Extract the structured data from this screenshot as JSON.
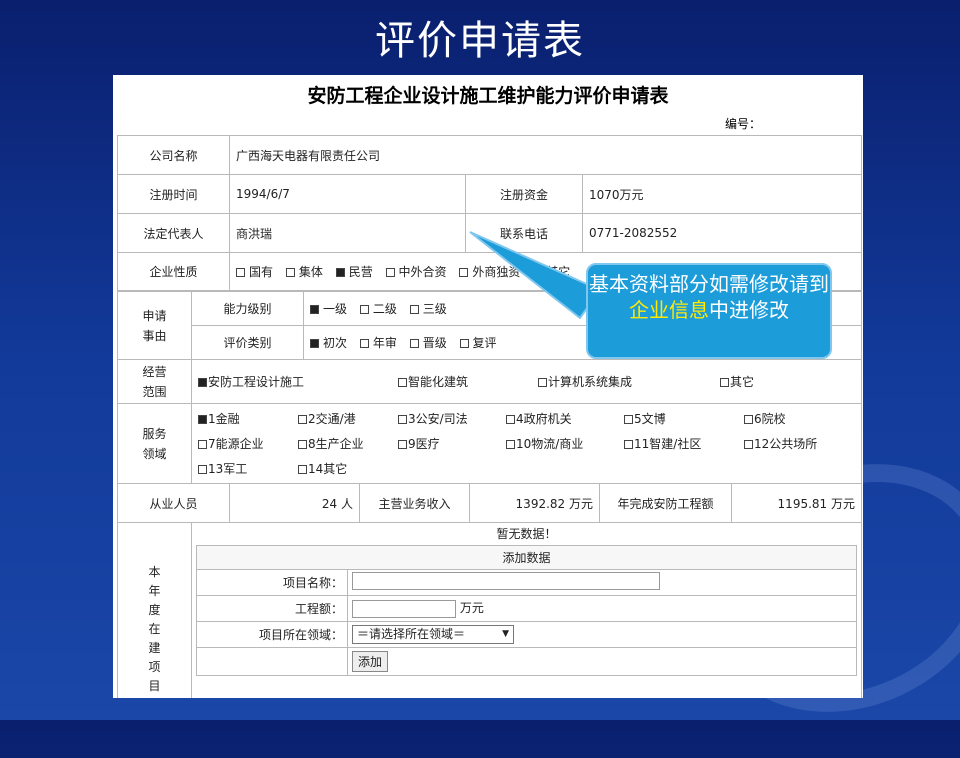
{
  "slide_title": "评价申请表",
  "form": {
    "title": "安防工程企业设计施工维护能力评价申请表",
    "serial_label": "编号：",
    "company_name_label": "公司名称",
    "company_name": "广西海天电器有限责任公司",
    "reg_date_label": "注册时间",
    "reg_date": "1994/6/7",
    "reg_capital_label": "注册资金",
    "reg_capital": "1070万元",
    "legal_rep_label": "法定代表人",
    "legal_rep": "商洪瑞",
    "phone_label": "联系电话",
    "phone": "0771-2082552",
    "nature_label": "企业性质",
    "nature_options": [
      {
        "label": "国有",
        "checked": false
      },
      {
        "label": "集体",
        "checked": false
      },
      {
        "label": "民营",
        "checked": true
      },
      {
        "label": "中外合资",
        "checked": false
      },
      {
        "label": "外商独资",
        "checked": false
      },
      {
        "label": "其它",
        "checked": false
      }
    ],
    "apply_label": "申请事由",
    "level_label": "能力级别",
    "level_options": [
      {
        "label": "一级",
        "checked": true
      },
      {
        "label": "二级",
        "checked": false
      },
      {
        "label": "三级",
        "checked": false
      }
    ],
    "eval_type_label": "评价类别",
    "eval_type_options": [
      {
        "label": "初次",
        "checked": true
      },
      {
        "label": "年审",
        "checked": false
      },
      {
        "label": "晋级",
        "checked": false
      },
      {
        "label": "复评",
        "checked": false
      }
    ],
    "scope_label": "经营范围",
    "scope_options": [
      {
        "label": "安防工程设计施工",
        "checked": true
      },
      {
        "label": "智能化建筑",
        "checked": false
      },
      {
        "label": "计算机系统集成",
        "checked": false
      },
      {
        "label": "其它",
        "checked": false
      }
    ],
    "service_label": "服务领域",
    "service_options": [
      {
        "label": "1金融",
        "checked": true
      },
      {
        "label": "2交通/港",
        "checked": false
      },
      {
        "label": "3公安/司法",
        "checked": false
      },
      {
        "label": "4政府机关",
        "checked": false
      },
      {
        "label": "5文博",
        "checked": false
      },
      {
        "label": "6院校",
        "checked": false
      },
      {
        "label": "7能源企业",
        "checked": false
      },
      {
        "label": "8生产企业",
        "checked": false
      },
      {
        "label": "9医疗",
        "checked": false
      },
      {
        "label": "10物流/商业",
        "checked": false
      },
      {
        "label": "11智建/社区",
        "checked": false
      },
      {
        "label": "12公共场所",
        "checked": false
      },
      {
        "label": "13军工",
        "checked": false
      },
      {
        "label": "14其它",
        "checked": false
      }
    ],
    "staff_label": "从业人员",
    "staff_value": "24 人",
    "revenue_label": "主营业务收入",
    "revenue_value": "1392.82 万元",
    "completed_label": "年完成安防工程额",
    "completed_value": "1195.81 万元",
    "projects_label": "本年度在建项目",
    "no_data": "暂无数据！",
    "add_data": "添加数据",
    "project_name_label": "项目名称：",
    "project_amount_label": "工程额：",
    "project_amount_unit": "万元",
    "project_field_label": "项目所在领域：",
    "project_field_select": "＝请选择所在领域＝",
    "add_button": "添加"
  },
  "callout": {
    "text_before": "基本资料部分如需修改请到",
    "highlight": "企业信息",
    "text_after": "中进修改"
  },
  "colors": {
    "background": "#123a9a",
    "callout": "#1c9cd8",
    "highlight": "#ffea00"
  }
}
